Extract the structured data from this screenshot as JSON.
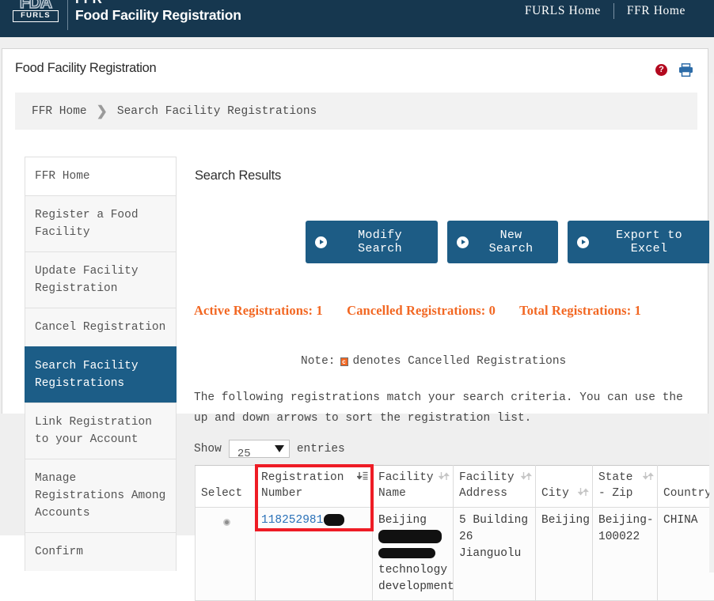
{
  "header": {
    "logo_fda": "FDA",
    "logo_furls": "FURLS",
    "app_abbrev": "FFR",
    "app_title": "Food Facility Registration",
    "nav": [
      {
        "label": "FURLS Home"
      },
      {
        "label": "FFR Home"
      }
    ]
  },
  "page": {
    "title": "Food Facility Registration",
    "help_icon_glyph": "?",
    "help_icon_name": "help-icon",
    "print_icon_name": "print-icon",
    "accent_navy": "#16374f",
    "accent_blue": "#1d5c85",
    "accent_orange": "#f26722",
    "highlight_red": "#ee1c25"
  },
  "breadcrumb": {
    "home_label": "FFR Home",
    "separator": "❯",
    "current_label": "Search Facility Registrations"
  },
  "sidebar": {
    "items": [
      {
        "label": "FFR Home",
        "active": false
      },
      {
        "label": "Register a Food Facility",
        "active": false
      },
      {
        "label": "Update Facility Registration",
        "active": false
      },
      {
        "label": "Cancel Registration",
        "active": false
      },
      {
        "label": "Search Facility Registrations",
        "active": true
      },
      {
        "label": "Link Registration to your Account",
        "active": false
      },
      {
        "label": "Manage Registrations Among Accounts",
        "active": false
      },
      {
        "label": "Confirm",
        "active": false
      }
    ]
  },
  "main": {
    "results_heading": "Search Results",
    "buttons": [
      {
        "label": "Modify Search"
      },
      {
        "label": "New Search"
      },
      {
        "label": "Export to Excel"
      }
    ],
    "stats": {
      "active_label": "Active Registrations:",
      "active_value": "1",
      "cancelled_label": "Cancelled Registrations:",
      "cancelled_value": "0",
      "total_label": "Total Registrations:",
      "total_value": "1"
    },
    "note": {
      "prefix": "Note:",
      "marker_glyph": "c",
      "text": "denotes Cancelled Registrations"
    },
    "intro_text": "The following registrations match your search criteria. You can use the up and down arrows to sort the registration list.",
    "show_entries": {
      "prefix": "Show",
      "value": "25",
      "suffix": "entries"
    },
    "table": {
      "columns": [
        {
          "label": "Select",
          "sortable": false,
          "sort_active": false
        },
        {
          "label": "Registration Number",
          "sortable": true,
          "sort_active": true
        },
        {
          "label": "Facility Name",
          "sortable": true,
          "sort_active": false
        },
        {
          "label": "Facility Address",
          "sortable": true,
          "sort_active": false
        },
        {
          "label": "City",
          "sortable": true,
          "sort_active": false
        },
        {
          "label": "State - Zip",
          "sortable": true,
          "sort_active": false
        },
        {
          "label": "Country",
          "sortable": true,
          "sort_active": false
        }
      ],
      "rows": [
        {
          "registration_number": "118252981",
          "registration_redacted": true,
          "facility_name_line1": "Beijing",
          "facility_name_redacted": true,
          "facility_name_line2": "technology",
          "facility_name_line3": "development",
          "facility_address": "5 Building 26 Jianguolu",
          "city": "Beijing",
          "state_zip": "Beijing-100022",
          "country": "CHINA"
        }
      ]
    }
  }
}
